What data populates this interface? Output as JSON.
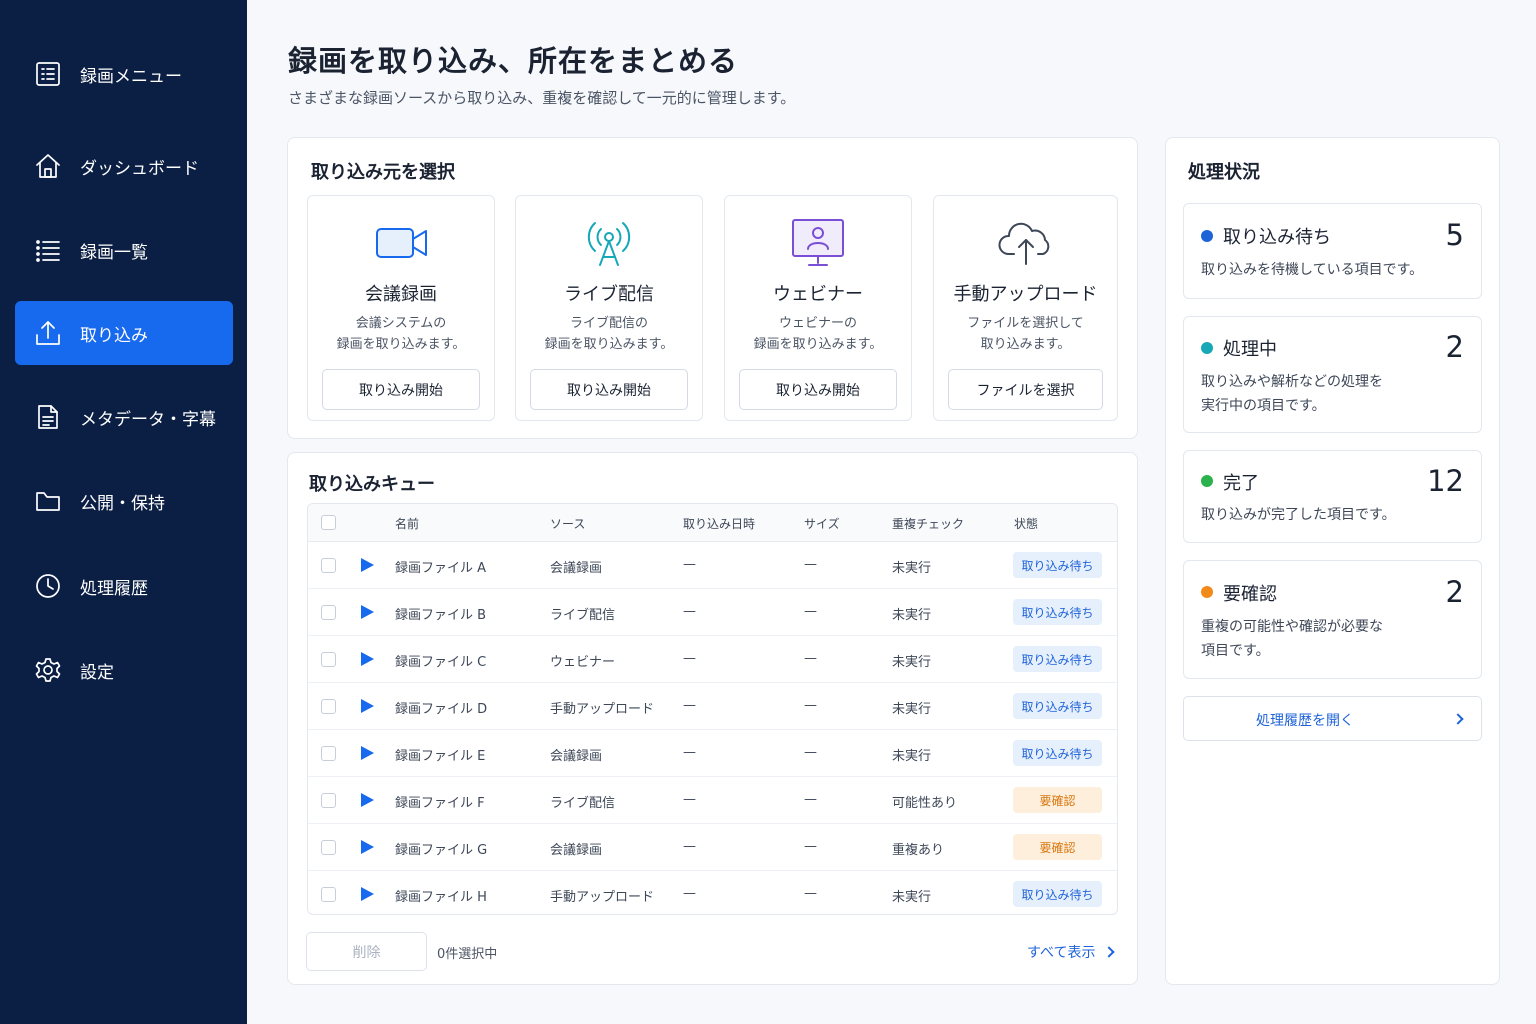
{
  "sidebar": {
    "items": [
      {
        "label": "録画メニュー",
        "icon": "menu-list-icon"
      },
      {
        "label": "ダッシュボード",
        "icon": "home-icon"
      },
      {
        "label": "録画一覧",
        "icon": "list-icon"
      },
      {
        "label": "取り込み",
        "icon": "upload-icon",
        "active": true
      },
      {
        "label": "メタデータ・字幕",
        "icon": "document-icon"
      },
      {
        "label": "公開・保持",
        "icon": "folder-icon"
      },
      {
        "label": "処理履歴",
        "icon": "clock-icon"
      },
      {
        "label": "設定",
        "icon": "gear-icon"
      }
    ]
  },
  "header": {
    "title": "録画を取り込み、所在をまとめる",
    "subtitle": "さまざまな録画ソースから取り込み、重複を確認して一元的に管理します。"
  },
  "sources": {
    "title": "取り込み元を選択",
    "cards": [
      {
        "title": "会議録画",
        "desc1": "会議システムの",
        "desc2": "録画を取り込みます。",
        "button": "取り込み開始",
        "icon": "video-camera-icon"
      },
      {
        "title": "ライブ配信",
        "desc1": "ライブ配信の",
        "desc2": "録画を取り込みます。",
        "button": "取り込み開始",
        "icon": "broadcast-antenna-icon"
      },
      {
        "title": "ウェビナー",
        "desc1": "ウェビナーの",
        "desc2": "録画を取り込みます。",
        "button": "取り込み開始",
        "icon": "webinar-monitor-icon"
      },
      {
        "title": "手動アップロード",
        "desc1": "ファイルを選択して",
        "desc2": "取り込みます。",
        "button": "ファイルを選択",
        "icon": "cloud-upload-icon"
      }
    ]
  },
  "queue": {
    "title": "取り込みキュー",
    "columns": [
      "名前",
      "ソース",
      "取り込み日時",
      "サイズ",
      "重複チェック",
      "状態"
    ],
    "rows": [
      {
        "name": "録画ファイル A",
        "source": "会議録画",
        "date": "—",
        "size": "—",
        "dup": "未実行",
        "status": "取り込み待ち",
        "status_kind": "wait"
      },
      {
        "name": "録画ファイル B",
        "source": "ライブ配信",
        "date": "—",
        "size": "—",
        "dup": "未実行",
        "status": "取り込み待ち",
        "status_kind": "wait"
      },
      {
        "name": "録画ファイル C",
        "source": "ウェビナー",
        "date": "—",
        "size": "—",
        "dup": "未実行",
        "status": "取り込み待ち",
        "status_kind": "wait"
      },
      {
        "name": "録画ファイル D",
        "source": "手動アップロード",
        "date": "—",
        "size": "—",
        "dup": "未実行",
        "status": "取り込み待ち",
        "status_kind": "wait"
      },
      {
        "name": "録画ファイル E",
        "source": "会議録画",
        "date": "—",
        "size": "—",
        "dup": "未実行",
        "status": "取り込み待ち",
        "status_kind": "wait"
      },
      {
        "name": "録画ファイル F",
        "source": "ライブ配信",
        "date": "—",
        "size": "—",
        "dup": "可能性あり",
        "status": "要確認",
        "status_kind": "check"
      },
      {
        "name": "録画ファイル G",
        "source": "会議録画",
        "date": "—",
        "size": "—",
        "dup": "重複あり",
        "status": "要確認",
        "status_kind": "check"
      },
      {
        "name": "録画ファイル H",
        "source": "手動アップロード",
        "date": "—",
        "size": "—",
        "dup": "未実行",
        "status": "取り込み待ち",
        "status_kind": "wait"
      }
    ],
    "delete_label": "削除",
    "selected_count": "0件選択中",
    "show_all": "すべて表示"
  },
  "status": {
    "title": "処理状況",
    "items": [
      {
        "label": "取り込み待ち",
        "count": "5",
        "desc1": "取り込みを待機している項目です。",
        "desc2": "",
        "color": "#1f63d8"
      },
      {
        "label": "処理中",
        "count": "2",
        "desc1": "取り込みや解析などの処理を",
        "desc2": "実行中の項目です。",
        "color": "#17a8b8"
      },
      {
        "label": "完了",
        "count": "12",
        "desc1": "取り込みが完了した項目です。",
        "desc2": "",
        "color": "#2bb24c"
      },
      {
        "label": "要確認",
        "count": "2",
        "desc1": "重複の可能性や確認が必要な",
        "desc2": "項目です。",
        "color": "#f28a1a"
      }
    ],
    "history_button": "処理履歴を開く"
  }
}
